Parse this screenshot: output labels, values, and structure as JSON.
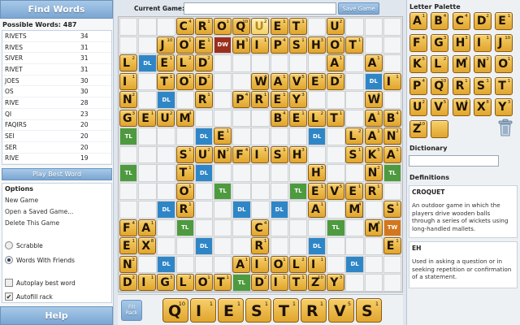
{
  "left": {
    "find_words": "Find Words",
    "possible_words": "Possible Words: 487",
    "words": [
      {
        "word": "RIVETS",
        "score": "34"
      },
      {
        "word": "RIVES",
        "score": "31"
      },
      {
        "word": "SIVER",
        "score": "31"
      },
      {
        "word": "RIVET",
        "score": "31"
      },
      {
        "word": "JOES",
        "score": "30"
      },
      {
        "word": "OS",
        "score": "30"
      },
      {
        "word": "RIVE",
        "score": "28"
      },
      {
        "word": "QI",
        "score": "23"
      },
      {
        "word": "FAQIRS",
        "score": "20"
      },
      {
        "word": "SEI",
        "score": "20"
      },
      {
        "word": "SER",
        "score": "20"
      },
      {
        "word": "RIVE",
        "score": "19"
      }
    ],
    "play_best": "Play Best Word",
    "options": {
      "title": "Options",
      "new_game": "New Game",
      "open_saved": "Open a Saved Game...",
      "delete": "Delete This Game",
      "scrabble": "Scrabble",
      "wwf": "Words With Friends",
      "autoplay": "Autoplay best word",
      "autofill": "Autofill rack",
      "selected_mode": "Words With Friends",
      "autoplay_checked": false,
      "autofill_checked": true
    },
    "help": "Help"
  },
  "top": {
    "current_game_label": "Current Game:",
    "current_game_value": "",
    "save_game": "Save Game"
  },
  "board": {
    "rows": [
      "...CROQUET.U...",
      "..JOE.HIPSHOT..",
      "L.ELD......A.A.",
      "I.TOD..WAVED..I",
      "N...R.PREY...W.",
      "GEUM....BELT.AB",
      ".....E......LANE",
      "...SUNFISH..SKA",
      "...T......H..N.",
      "...O......EVER.",
      "...R......A.M.S",
      "FA.....C.....M.",
      "EX.....R......E",
      "N.....AIOLI....",
      "DIGLOT.DITZY...."
    ],
    "new_tiles": [
      [
        0,
        7
      ]
    ],
    "bonus": [
      {
        "r": 1,
        "c": 5,
        "type": "DW"
      },
      {
        "r": 2,
        "c": 1,
        "type": "DL"
      },
      {
        "r": 2,
        "c": 13,
        "type": "DL"
      },
      {
        "r": 3,
        "c": 13,
        "type": "DL"
      },
      {
        "r": 4,
        "c": 2,
        "type": "DL"
      },
      {
        "r": 6,
        "c": 0,
        "type": "TL"
      },
      {
        "r": 6,
        "c": 4,
        "type": "DL"
      },
      {
        "r": 6,
        "c": 10,
        "type": "DL"
      },
      {
        "r": 6,
        "c": 14,
        "type": "TL"
      },
      {
        "r": 8,
        "c": 0,
        "type": "TL"
      },
      {
        "r": 8,
        "c": 4,
        "type": "DL"
      },
      {
        "r": 8,
        "c": 10,
        "type": "DL"
      },
      {
        "r": 8,
        "c": 14,
        "type": "TL"
      },
      {
        "r": 9,
        "c": 5,
        "type": "TL"
      },
      {
        "r": 9,
        "c": 9,
        "type": "TL"
      },
      {
        "r": 10,
        "c": 2,
        "type": "DL"
      },
      {
        "r": 10,
        "c": 6,
        "type": "DL"
      },
      {
        "r": 10,
        "c": 8,
        "type": "DL"
      },
      {
        "r": 10,
        "c": 12,
        "type": "DL"
      },
      {
        "r": 11,
        "c": 3,
        "type": "TL"
      },
      {
        "r": 11,
        "c": 11,
        "type": "TL"
      },
      {
        "r": 11,
        "c": 14,
        "type": "TW"
      },
      {
        "r": 12,
        "c": 4,
        "type": "DL"
      },
      {
        "r": 12,
        "c": 10,
        "type": "DL"
      },
      {
        "r": 13,
        "c": 2,
        "type": "DL"
      },
      {
        "r": 13,
        "c": 12,
        "type": "DL"
      },
      {
        "r": 14,
        "c": 6,
        "type": "TL"
      }
    ]
  },
  "rack": {
    "fill_rack": "Fill Rack",
    "tiles": [
      "Q",
      "I",
      "E",
      "S",
      "T",
      "R",
      "V",
      "S"
    ]
  },
  "letter_points": {
    "A": "1",
    "B": "4",
    "C": "4",
    "D": "2",
    "E": "1",
    "F": "4",
    "G": "3",
    "H": "3",
    "I": "1",
    "J": "10",
    "K": "5",
    "L": "2",
    "M": "4",
    "N": "2",
    "O": "1",
    "P": "4",
    "Q": "10",
    "R": "1",
    "S": "1",
    "T": "1",
    "U": "2",
    "V": "5",
    "W": "4",
    "X": "8",
    "Y": "3",
    "Z": "10"
  },
  "right": {
    "palette_title": "Letter Palette",
    "palette": [
      "A",
      "B",
      "C",
      "D",
      "E",
      "F",
      "G",
      "H",
      "I",
      "J",
      "K",
      "L",
      "M",
      "N",
      "O",
      "P",
      "Q",
      "R",
      "S",
      "T",
      "U",
      "V",
      "W",
      "X",
      "Y",
      "Z",
      ""
    ],
    "dictionary_title": "Dictionary",
    "dictionary_value": "",
    "definitions_title": "Definitions",
    "definitions": [
      {
        "word": "CROQUET",
        "text": "An outdoor game in which the players drive wooden balls through a series of wickets using long-handled mallets."
      },
      {
        "word": "EH",
        "text": "Used in asking a question or in seeking repetition or confirmation of a statement."
      }
    ]
  }
}
